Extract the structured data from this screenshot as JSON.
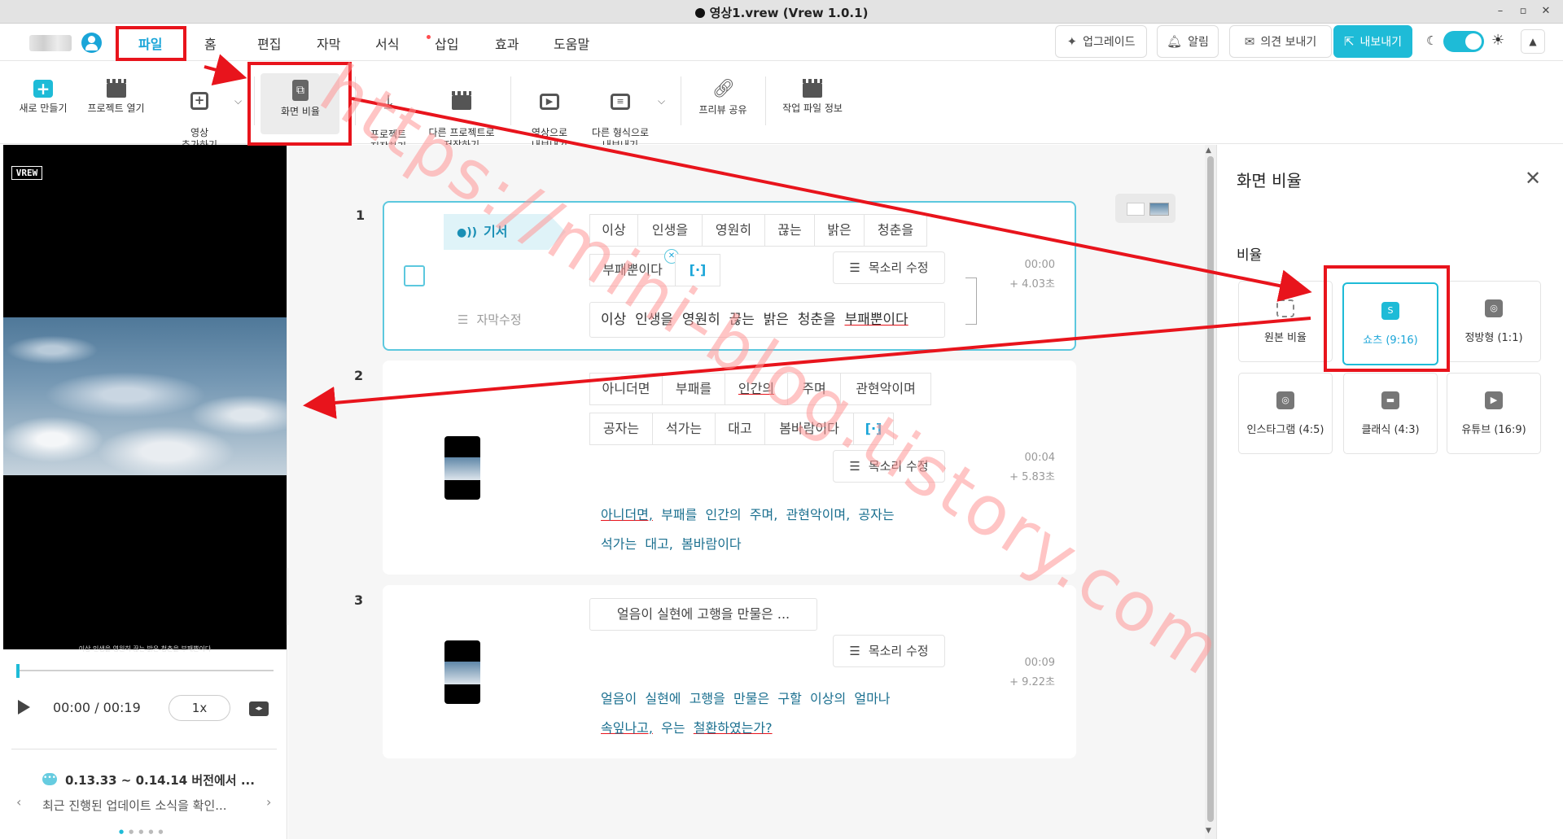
{
  "window": {
    "title": "영상1.vrew (Vrew 1.0.1)",
    "controls": [
      "–",
      "▫",
      "✕"
    ]
  },
  "menu": {
    "items": [
      {
        "label": "파일",
        "active": true
      },
      {
        "label": "홈"
      },
      {
        "label": "편집"
      },
      {
        "label": "자막"
      },
      {
        "label": "서식"
      },
      {
        "label": "삽입",
        "badge": true
      },
      {
        "label": "효과"
      },
      {
        "label": "도움말"
      }
    ],
    "right": {
      "upgrade": "업그레이드",
      "alarm": "알림",
      "feedback": "의견 보내기",
      "export": "내보내기"
    }
  },
  "toolbar": {
    "items": [
      {
        "label": "새로 만들기",
        "icon": "plus-icon"
      },
      {
        "label": "프로젝트 열기",
        "icon": "clapper-icon"
      },
      {
        "label": "영상\n추가하기",
        "icon": "add-video-icon"
      },
      {
        "label": "화면 비율",
        "icon": "ratio-icon"
      },
      {
        "label": "프로젝트\n저장하기",
        "icon": "download-icon"
      },
      {
        "label": "다른 프로젝트로\n저장하기",
        "icon": "clapper-save-icon"
      },
      {
        "label": "영상으로\n내보내기",
        "icon": "export-video-icon"
      },
      {
        "label": "다른 형식으로\n내보내기",
        "icon": "export-format-icon"
      },
      {
        "label": "프리뷰 공유",
        "icon": "link-icon"
      },
      {
        "label": "작업 파일 정보",
        "icon": "file-info-icon"
      }
    ]
  },
  "preview": {
    "logo": "VREW",
    "subtitle": "이상 인생을 영원히 끊는 밝은 청춘을 부패뿐이다",
    "time": "00:00 / 00:19",
    "speed": "1x",
    "progress": 0.0
  },
  "notice": {
    "title": "0.13.33 ~ 0.14.14 버전에서 ...",
    "body": "최근 진행된 업데이트 소식을 확인..."
  },
  "clips": [
    {
      "number": "1",
      "speaker": "기서",
      "words_row1": [
        "이상",
        "인생을",
        "영원히",
        "끊는",
        "밝은",
        "청춘을"
      ],
      "words_row2": [
        "부패뿐이다",
        "[·]"
      ],
      "voice_btn": "목소리 수정",
      "time_start": "00:00",
      "time_dur": "+ 4.03초",
      "sub_edit_label": "자막수정",
      "subtitle_words": [
        "이상",
        "인생을",
        "영원히",
        "끊는",
        "밝은",
        "청춘을",
        "부패뿐이다"
      ]
    },
    {
      "number": "2",
      "words_row1": [
        "아니더면",
        "부패를",
        "인간의",
        "주며",
        "관현악이며"
      ],
      "words_row2": [
        "공자는",
        "석가는",
        "대고",
        "봄바람이다",
        "[·]"
      ],
      "voice_btn": "목소리 수정",
      "time_start": "00:04",
      "time_dur": "+ 5.83초",
      "subtitle_line1": [
        "아니더면,",
        "부패를",
        "인간의",
        "주며,",
        "관현악이며,",
        "공자는"
      ],
      "subtitle_line2": [
        "석가는",
        "대고,",
        "봄바람이다"
      ]
    },
    {
      "number": "3",
      "words_row1": [
        "얼음이 실현에 고행을 만물은 ..."
      ],
      "voice_btn": "목소리 수정",
      "time_start": "00:09",
      "time_dur": "+ 9.22초",
      "subtitle_line1": [
        "얼음이",
        "실현에",
        "고행을",
        "만물은",
        "구할",
        "이상의",
        "얼마나"
      ],
      "subtitle_line2": [
        "속잎나고,",
        "우는",
        "철환하였는가?"
      ]
    }
  ],
  "ratio_panel": {
    "title": "화면 비율",
    "section": "비율",
    "options": [
      {
        "label": "원본 비율",
        "icon": "original-ratio-icon"
      },
      {
        "label": "쇼츠 (9:16)",
        "icon": "shorts-icon",
        "selected": true
      },
      {
        "label": "정방형 (1:1)",
        "icon": "square-icon"
      },
      {
        "label": "인스타그램 (4:5)",
        "icon": "instagram-icon"
      },
      {
        "label": "클래식 (4:3)",
        "icon": "classic-icon"
      },
      {
        "label": "유튜브 (16:9)",
        "icon": "youtube-icon"
      }
    ]
  },
  "watermark": "https://mini-blog.tistory.com",
  "colors": {
    "accent": "#1ebbd7",
    "annotation": "#e8141c"
  }
}
